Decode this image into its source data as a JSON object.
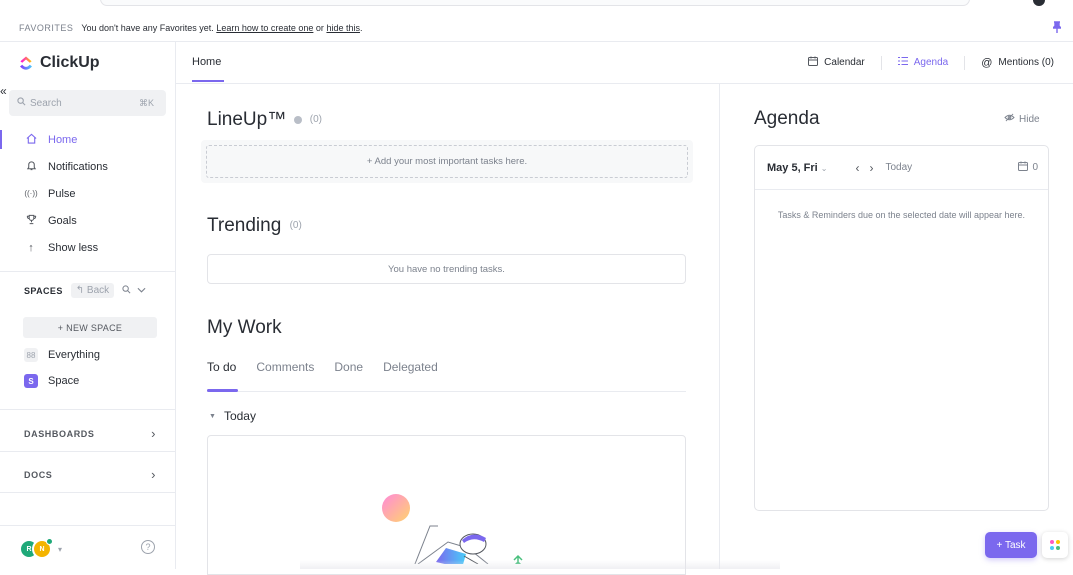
{
  "favorites": {
    "title": "FAVORITES",
    "message": "You don't have any Favorites yet.",
    "learn_link": "Learn how to create one",
    "or_text": "or",
    "hide_link": "hide this",
    "period": "."
  },
  "sidebar": {
    "logo_text": "ClickUp",
    "collapse_glyph": "«",
    "search_placeholder": "Search",
    "search_shortcut": "⌘K",
    "nav_items": [
      {
        "label": "Home",
        "icon": "home-icon",
        "glyph": "⌂"
      },
      {
        "label": "Notifications",
        "icon": "bell-icon",
        "glyph": "🔔"
      },
      {
        "label": "Pulse",
        "icon": "pulse-icon",
        "glyph": "((·))"
      },
      {
        "label": "Goals",
        "icon": "trophy-icon",
        "glyph": "🏆"
      },
      {
        "label": "Show less",
        "icon": "arrow-up-icon",
        "glyph": "↑"
      }
    ],
    "spaces_label": "SPACES",
    "back_label": "Back",
    "new_space_label": "+ NEW SPACE",
    "spaces": [
      {
        "label": "Everything",
        "badge": "88"
      },
      {
        "label": "Space",
        "badge": "S"
      }
    ],
    "dashboards_label": "DASHBOARDS",
    "docs_label": "DOCS",
    "user_initials": [
      "R",
      "N"
    ]
  },
  "header": {
    "tab_home": "Home",
    "calendar_label": "Calendar",
    "agenda_label": "Agenda",
    "mentions_label": "Mentions (0)"
  },
  "lineup": {
    "title": "LineUp™",
    "count": "(0)",
    "add_text": "+ Add your most important tasks here."
  },
  "trending": {
    "title": "Trending",
    "count": "(0)",
    "empty_text": "You have no trending tasks."
  },
  "my_work": {
    "title": "My Work",
    "tabs": [
      "To do",
      "Comments",
      "Done",
      "Delegated"
    ],
    "active_tab": "To do",
    "group_label": "Today"
  },
  "agenda": {
    "title": "Agenda",
    "hide_label": "Hide",
    "date_label": "May 5, Fri",
    "today_label": "Today",
    "calendar_count": "0",
    "empty_text": "Tasks & Reminders due on the selected date will appear here."
  },
  "fab": {
    "task_label": "+ Task"
  },
  "colors": {
    "accent": "#7b68ee",
    "text": "#292d34",
    "muted": "#7c828d",
    "border": "#e9ebf0"
  }
}
